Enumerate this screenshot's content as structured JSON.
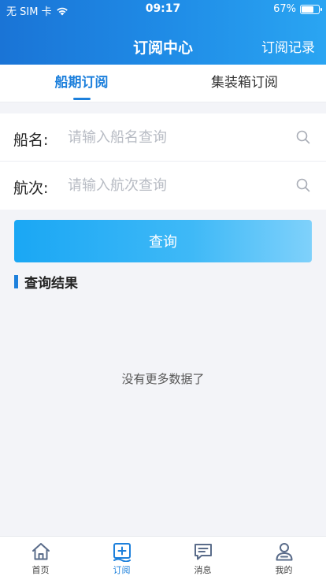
{
  "status_bar": {
    "carrier": "无 SIM 卡",
    "time": "09:17",
    "battery": "67%"
  },
  "nav": {
    "title": "订阅中心",
    "right_action": "订阅记录"
  },
  "tabs": [
    {
      "label": "船期订阅",
      "active": true
    },
    {
      "label": "集装箱订阅",
      "active": false
    }
  ],
  "form": {
    "ship_name": {
      "label": "船名:",
      "placeholder": "请输入船名查询",
      "value": ""
    },
    "voyage": {
      "label": "航次:",
      "placeholder": "请输入航次查询",
      "value": ""
    }
  },
  "query_button": "查询",
  "results": {
    "title": "查询结果",
    "empty_text": "没有更多数据了"
  },
  "bottom_tabs": [
    {
      "label": "首页",
      "icon": "home-icon",
      "active": false
    },
    {
      "label": "订阅",
      "icon": "subscribe-icon",
      "active": true
    },
    {
      "label": "消息",
      "icon": "message-icon",
      "active": false
    },
    {
      "label": "我的",
      "icon": "profile-icon",
      "active": false
    }
  ],
  "colors": {
    "accent": "#1d80dc",
    "header_start": "#1a74d6",
    "header_end": "#2aa5f2",
    "button_start": "#1aa7f4",
    "button_end": "#7fd1fb",
    "background": "#f3f4f8"
  }
}
